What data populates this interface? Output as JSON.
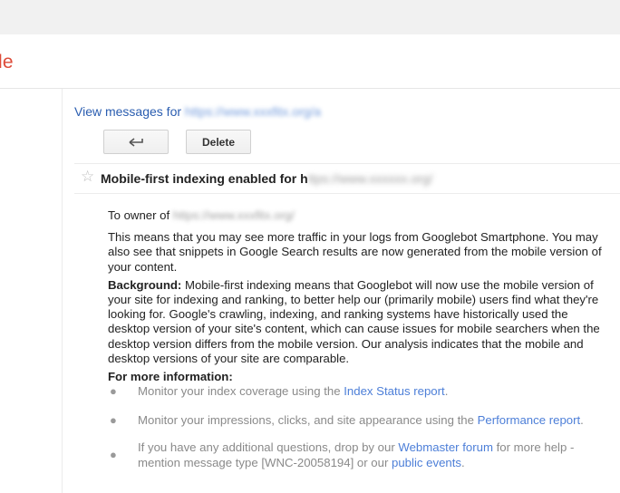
{
  "header": {
    "brand_fragment": "le"
  },
  "nav": {
    "view_messages_label": "View messages for",
    "site_url": "https://www.xxxfitx.org/a"
  },
  "toolbar": {
    "back_icon": "back-arrow-icon",
    "delete_label": "Delete"
  },
  "message": {
    "star_icon": "star-outline-icon",
    "subject": "Mobile-first indexing enabled for h",
    "subject_blurred": "ttps://www.xxxxxx.org/",
    "owner_prefix": "To owner of",
    "owner_site": "https://www.xxxfitx.org/",
    "paragraph1": "This means that you may see more traffic in your logs from Googlebot Smartphone. You may also see that snippets in Google Search results are now generated from the mobile version of your content.",
    "background_label": "Background:",
    "background_text": " Mobile-first indexing means that Googlebot will now use the mobile version of your site for indexing and ranking, to better help our (primarily mobile) users find what they're looking for. Google's crawling, indexing, and ranking systems have historically used the desktop version of your site's content, which can cause issues for mobile searchers when the desktop version differs from the mobile version. Our analysis indicates that the mobile and desktop versions of your site are comparable.",
    "more_info_label": "For more information:",
    "bullets": [
      {
        "text_before": "Monitor your index coverage using the ",
        "link": "Index Status report",
        "text_after": "."
      },
      {
        "text_before": "Monitor your impressions, clicks, and site appearance using the ",
        "link": "Performance report",
        "text_after": "."
      },
      {
        "text_before": "If you have any additional questions, drop by our ",
        "link": "Webmaster forum",
        "text_middle": " for more help - mention message type [WNC-20058194] or our ",
        "link2": "public events",
        "text_after": "."
      }
    ]
  },
  "colors": {
    "brand_red": "#dd4b39",
    "link_blue": "#2a5db0",
    "bullet_gray": "#8a8a8a"
  }
}
